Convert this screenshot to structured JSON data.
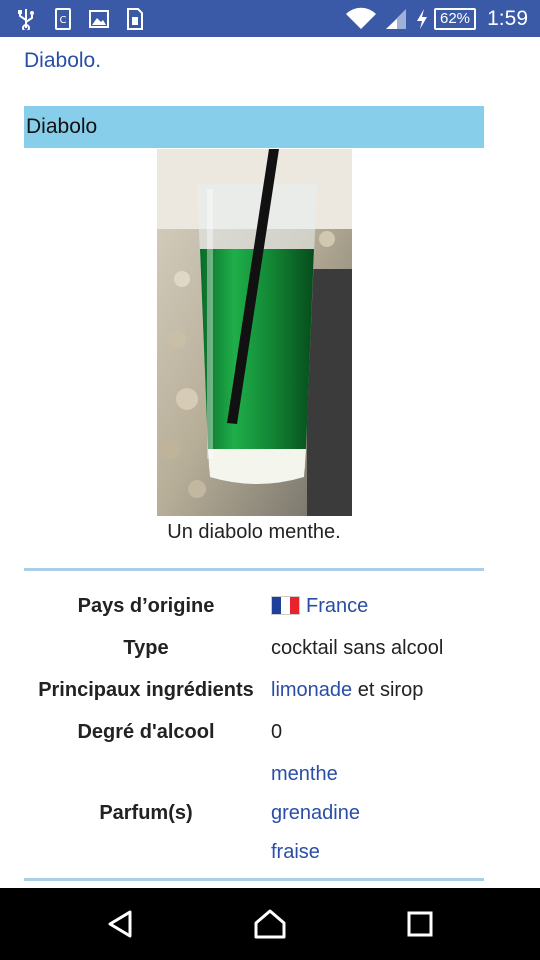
{
  "status_bar": {
    "battery_percent": "62%",
    "time": "1:59",
    "icons": [
      "usb-icon",
      "screenshot-icon",
      "image-icon",
      "sim-icon",
      "wifi-icon",
      "signal-icon",
      "charging-icon",
      "battery-icon"
    ]
  },
  "page": {
    "top_link": "Diabolo."
  },
  "infobox": {
    "title": "Diabolo",
    "caption": "Un diabolo menthe.",
    "rows": {
      "origin": {
        "label": "Pays d’origine",
        "value": "France"
      },
      "type": {
        "label": "Type",
        "value": "cocktail sans alcool"
      },
      "ingredients": {
        "label": "Principaux ingrédients",
        "link": "limonade",
        "rest": " et sirop"
      },
      "alcohol": {
        "label": "Degré d'alcool",
        "value": "0"
      },
      "flavours": {
        "label": "Parfum(s)",
        "values": [
          "menthe",
          "grenadine",
          "fraise"
        ]
      }
    }
  },
  "nav_bar": {
    "icons": [
      "back-icon",
      "home-icon",
      "recents-icon"
    ]
  },
  "colors": {
    "status_bar": "#3a5aa8",
    "infobox_header": "#87ceeb",
    "link": "#2a4ea6",
    "rule": "#a8cfe6"
  }
}
